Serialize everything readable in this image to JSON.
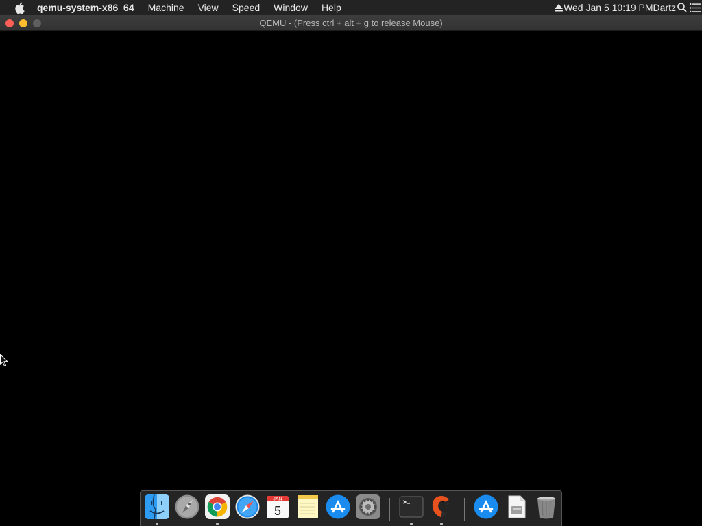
{
  "menubar": {
    "app_name": "qemu-system-x86_64",
    "items": [
      "Machine",
      "View",
      "Speed",
      "Window",
      "Help"
    ],
    "clock": "Wed Jan 5  10:19 PM",
    "user": "Dartz"
  },
  "window": {
    "title": "QEMU - (Press ctrl + alt + g to release Mouse)"
  },
  "dock": {
    "calendar": {
      "month": "JAN",
      "day": "5"
    },
    "apps": [
      "finder",
      "launchpad",
      "chrome",
      "safari",
      "calendar",
      "notes",
      "app-store",
      "system-preferences",
      "terminal",
      "qemu",
      "app-store-downloads",
      "documents",
      "trash"
    ]
  }
}
